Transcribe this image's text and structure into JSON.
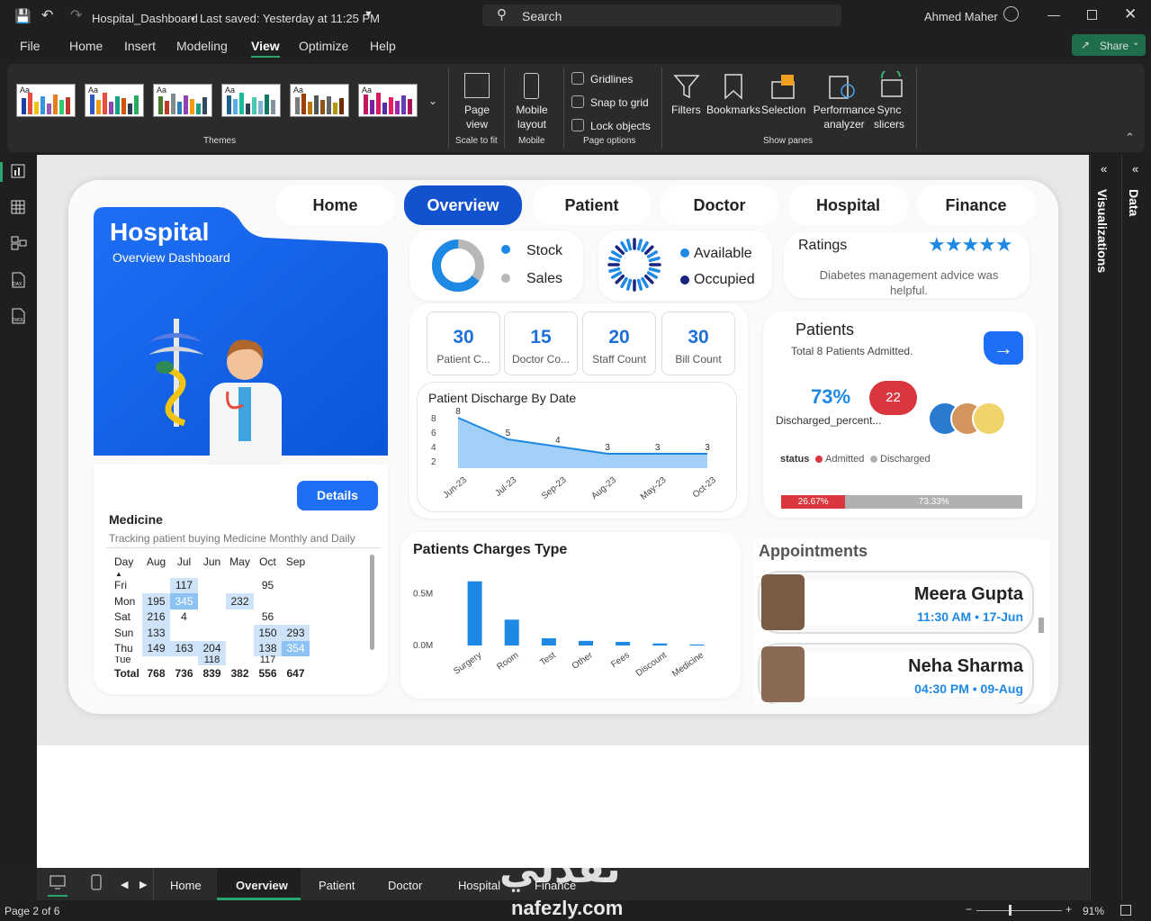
{
  "titlebar": {
    "filename": "Hospital_Dashboard",
    "saved": "Last saved: Yesterday at 11:25 PM",
    "search": "Search",
    "user": "Ahmed Maher"
  },
  "menu": [
    "File",
    "Home",
    "Insert",
    "Modeling",
    "View",
    "Optimize",
    "Help"
  ],
  "share": "Share",
  "ribbon": {
    "themes_label": "Themes",
    "page_view": "Page view",
    "scale_to_fit": "Scale to fit",
    "mobile_layout": "Mobile layout",
    "mobile": "Mobile",
    "gridlines": "Gridlines",
    "snap": "Snap to grid",
    "lock": "Lock objects",
    "page_options": "Page options",
    "filters": "Filters",
    "bookmarks": "Bookmarks",
    "selection": "Selection",
    "performance": "Performance analyzer",
    "sync": "Sync slicers",
    "show_panes": "Show panes",
    "theme_aa": "Aa"
  },
  "panes": {
    "visualizations": "Visualizations",
    "data": "Data"
  },
  "nav": [
    "Home",
    "Overview",
    "Patient",
    "Doctor",
    "Hospital",
    "Finance"
  ],
  "hero": {
    "title": "Hospital",
    "subtitle": "Overview Dashboard",
    "details": "Details"
  },
  "stock": {
    "stock": "Stock",
    "sales": "Sales"
  },
  "beds": {
    "available": "Available",
    "occupied": "Occupied"
  },
  "ratings": {
    "title": "Ratings",
    "stars": "★★★★★",
    "text": "Diabetes management advice was helpful."
  },
  "kpis": [
    {
      "value": "30",
      "label": "Patient C..."
    },
    {
      "value": "15",
      "label": "Doctor Co..."
    },
    {
      "value": "20",
      "label": "Staff Count"
    },
    {
      "value": "30",
      "label": "Bill Count"
    }
  ],
  "patients": {
    "title": "Patients",
    "sub": "Total 8 Patients Admitted.",
    "pct": "73%",
    "badge": "22",
    "pct_label": "Discharged_percent...",
    "status": "status",
    "admitted": "Admitted",
    "discharged": "Discharged",
    "bar_admitted": "26.67%",
    "bar_discharged": "73.33%",
    "admitted_share": 0.2667
  },
  "medicine": {
    "title": "Medicine",
    "sub": "Tracking patient buying Medicine Monthly and Daily",
    "headers": [
      "Day",
      "Aug",
      "Jul",
      "Jun",
      "May",
      "Oct",
      "Sep"
    ],
    "rows": [
      [
        "Fri",
        "",
        "117",
        "",
        "",
        "95",
        ""
      ],
      [
        "Mon",
        "195",
        "345",
        "",
        "232",
        "",
        ""
      ],
      [
        "Sat",
        "216",
        "4",
        "",
        "",
        "56",
        ""
      ],
      [
        "Sun",
        "133",
        "",
        "",
        "",
        "150",
        "293"
      ],
      [
        "Thu",
        "149",
        "163",
        "204",
        "",
        "138",
        "354"
      ],
      [
        "Tue",
        "",
        "",
        "118",
        "",
        "117",
        ""
      ]
    ],
    "total": [
      "Total",
      "768",
      "736",
      "839",
      "382",
      "556",
      "647"
    ]
  },
  "appointments": {
    "title": "Appointments",
    "items": [
      {
        "name": "Meera Gupta",
        "time": "11:30 AM • 17-Jun"
      },
      {
        "name": "Neha Sharma",
        "time": "04:30 PM • 09-Aug"
      }
    ]
  },
  "colors": {
    "accent": "#1252cf",
    "chart": "#1e88e5",
    "admitted": "#d9363e",
    "discharged": "#b0b0b0"
  },
  "bottom": {
    "tabs": [
      "Home",
      "Overview",
      "Patient",
      "Doctor",
      "Hospital",
      "Finance"
    ],
    "page": "Page 2 of 6",
    "zoom": "91%"
  },
  "watermark": {
    "arabic": "نفذلي",
    "site": "nafezly.com"
  },
  "chart_data": [
    {
      "type": "area",
      "title": "Patient Discharge By Date",
      "categories": [
        "Jun-23",
        "Jul-23",
        "Sep-23",
        "Aug-23",
        "May-23",
        "Oct-23"
      ],
      "values": [
        8,
        5,
        4,
        3,
        3,
        3
      ],
      "point_labels": [
        "8",
        "5",
        "4",
        "3",
        "3",
        "3"
      ],
      "yticks": [
        "2",
        "4",
        "6",
        "8"
      ],
      "ylim": [
        1,
        8.5
      ]
    },
    {
      "type": "bar",
      "title": "Patients Charges Type",
      "categories": [
        "Surgery",
        "Room",
        "Test",
        "Other",
        "Fees",
        "Discount",
        "Medicine"
      ],
      "values": [
        0.62,
        0.25,
        0.07,
        0.045,
        0.035,
        0.02,
        0.01
      ],
      "yticks": [
        "0.0M",
        "0.5M"
      ],
      "ylim": [
        0,
        0.8
      ]
    },
    {
      "type": "pie",
      "title": "",
      "categories": [
        "Stock",
        "Sales"
      ],
      "values": [
        35,
        65
      ]
    }
  ]
}
